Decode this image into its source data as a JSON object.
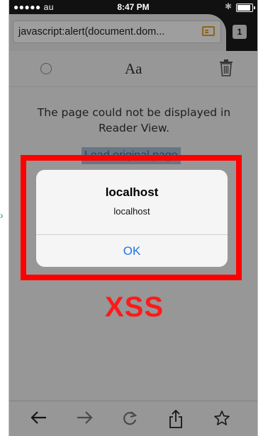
{
  "status_bar": {
    "carrier": "●●●●● au",
    "time": "8:47 PM"
  },
  "url_bar": {
    "url": "javascript:alert(document.dom...",
    "tab_count": "1"
  },
  "reader_toolbar": {
    "font_label": "Aa"
  },
  "content": {
    "message": "The page could not be displayed in Reader View.",
    "load_link": "Load original page"
  },
  "alert": {
    "title": "localhost",
    "message": "localhost",
    "ok_label": "OK"
  },
  "annotation": {
    "label": "XSS",
    "color": "#ff0000"
  },
  "bottom_toolbar": {
    "icons": [
      "back-arrow-icon",
      "forward-arrow-icon",
      "reload-icon",
      "share-icon",
      "star-icon"
    ]
  },
  "colors": {
    "link": "#2f6db0",
    "ok_button": "#1e73e8",
    "reader_icon": "#e8a12a"
  }
}
